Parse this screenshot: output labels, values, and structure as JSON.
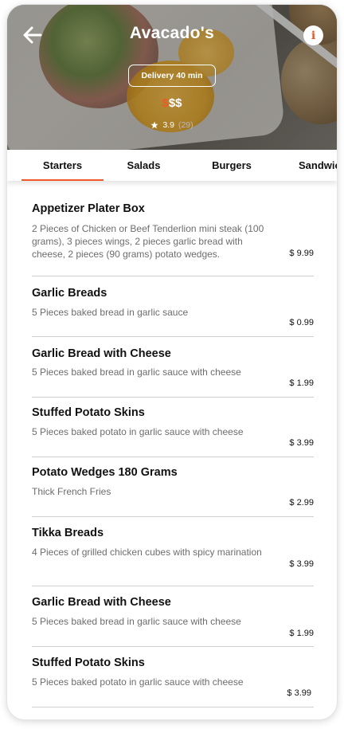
{
  "header": {
    "title": "Avacado's",
    "delivery_label": "Delivery 40 min",
    "price_level_active": "$",
    "price_level_rest": "$$",
    "rating_value": "3.9",
    "rating_count": "(29)"
  },
  "tabs": [
    {
      "label": "Starters",
      "active": true
    },
    {
      "label": "Salads",
      "active": false
    },
    {
      "label": "Burgers",
      "active": false
    },
    {
      "label": "Sandwiches",
      "active": false
    }
  ],
  "menu": {
    "items": [
      {
        "name": "Appetizer Plater Box",
        "description": "2 Pieces of Chicken or Beef Tenderlion mini steak (100 grams), 3 pieces wings, 2 pieces garlic bread with cheese, 2 pieces (90 grams) potato wedges.",
        "price": "$ 9.99"
      },
      {
        "name": "Garlic Breads",
        "description": "5 Pieces baked bread in garlic sauce",
        "price": "$ 0.99"
      },
      {
        "name": "Garlic Bread with Cheese",
        "description": "5 Pieces baked bread in garlic sauce with cheese",
        "price": "$ 1.99"
      },
      {
        "name": "Stuffed Potato Skins",
        "description": "5 Pieces baked potato in garlic sauce with cheese",
        "price": "$ 3.99"
      },
      {
        "name": "Potato Wedges 180 Grams",
        "description": "Thick French Fries",
        "price": "$ 2.99"
      },
      {
        "name": "Tikka Breads",
        "description": "4 Pieces of grilled chicken cubes with spicy marination",
        "price": "$ 3.99"
      },
      {
        "name": "Garlic Bread with Cheese",
        "description": "5 Pieces baked bread in garlic sauce with cheese",
        "price": "$ 1.99"
      },
      {
        "name": "Stuffed Potato Skins",
        "description": "5 Pieces baked potato in garlic sauce with cheese",
        "price": "$ 3.99"
      }
    ]
  },
  "icons": {
    "back": "arrow-left-icon",
    "info": "info-icon",
    "star": "star-icon"
  },
  "colors": {
    "accent": "#ef5a26"
  }
}
